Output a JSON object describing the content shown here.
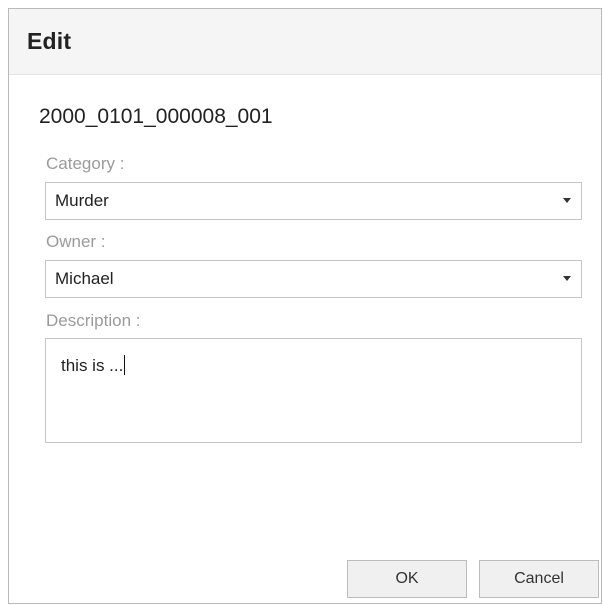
{
  "dialog": {
    "title": "Edit",
    "record_id": "2000_0101_000008_001"
  },
  "form": {
    "category": {
      "label": "Category :",
      "value": "Murder"
    },
    "owner": {
      "label": "Owner :",
      "value": "Michael"
    },
    "description": {
      "label": "Description :",
      "value": "this is ..."
    }
  },
  "buttons": {
    "ok_label": "OK",
    "cancel_label": "Cancel"
  },
  "icons": {
    "category_dropdown": "chevron-down-icon",
    "owner_dropdown": "chevron-down-icon"
  },
  "colors": {
    "title_bar": "#f5f5f5",
    "label_text": "#9b9b9b",
    "border": "#c5c5c5",
    "button_bg": "#f0f0f0"
  }
}
